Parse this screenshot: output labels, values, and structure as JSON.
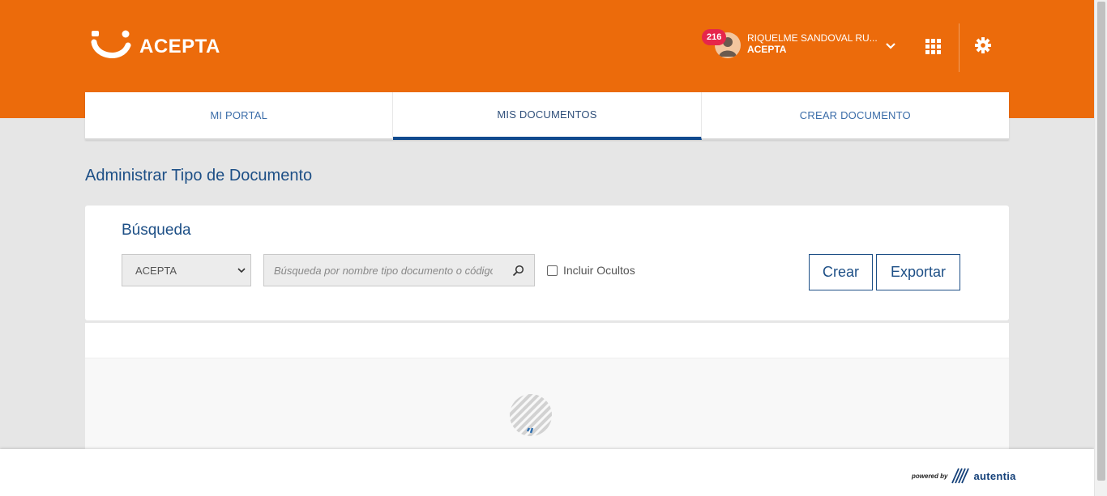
{
  "header": {
    "brand": "ACEPTA",
    "notification_count": "216",
    "user_name": "RIQUELME SANDOVAL RU...",
    "user_org": "ACEPTA"
  },
  "tabs": [
    {
      "label": "MI PORTAL",
      "active": false
    },
    {
      "label": "MIS DOCUMENTOS",
      "active": true
    },
    {
      "label": "CREAR DOCUMENTO",
      "active": false
    }
  ],
  "page": {
    "title": "Administrar Tipo de Documento"
  },
  "search": {
    "section_title": "Búsqueda",
    "company_select_value": "ACEPTA",
    "query_placeholder": "Búsqueda por nombre tipo documento o código",
    "include_hidden_label": "Incluir Ocultos",
    "create_label": "Crear",
    "export_label": "Exportar"
  },
  "footer": {
    "powered_by": "powered by",
    "vendor": "autentia"
  },
  "colors": {
    "brand_orange": "#ec6b0b",
    "primary_blue": "#1d4f86",
    "badge_red": "#e6264b"
  }
}
